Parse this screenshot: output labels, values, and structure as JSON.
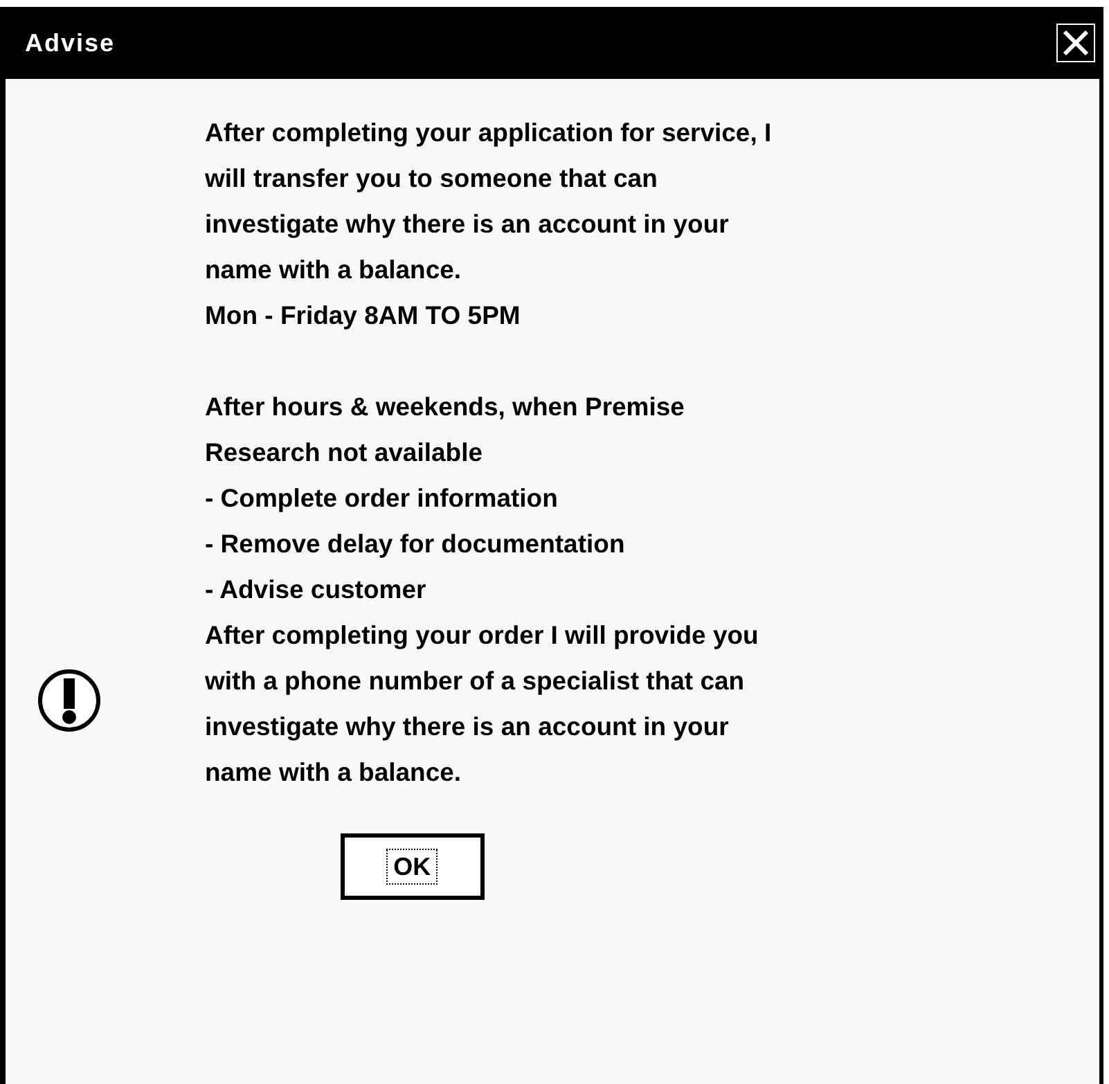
{
  "window": {
    "title": "Advise"
  },
  "message": [
    {
      "kind": "paragraph",
      "lines": [
        "After completing your application for service, I",
        "will transfer you to someone that can",
        "investigate why there is an account in your",
        "name with a balance."
      ]
    },
    {
      "kind": "paragraph",
      "lines": [
        "Mon - Friday 8AM TO 5PM"
      ]
    },
    {
      "kind": "gap"
    },
    {
      "kind": "paragraph",
      "lines": [
        "After hours & weekends, when Premise",
        "Research not available"
      ]
    },
    {
      "kind": "paragraph",
      "lines": [
        "- Complete order information"
      ]
    },
    {
      "kind": "paragraph",
      "lines": [
        "- Remove delay for documentation"
      ]
    },
    {
      "kind": "paragraph",
      "lines": [
        "- Advise customer"
      ]
    },
    {
      "kind": "paragraph",
      "lines": [
        "After completing your order I will provide you",
        "with a phone number of a specialist that can",
        "investigate why there is an account in your",
        "name with a balance."
      ]
    }
  ],
  "buttons": [
    "OK"
  ]
}
